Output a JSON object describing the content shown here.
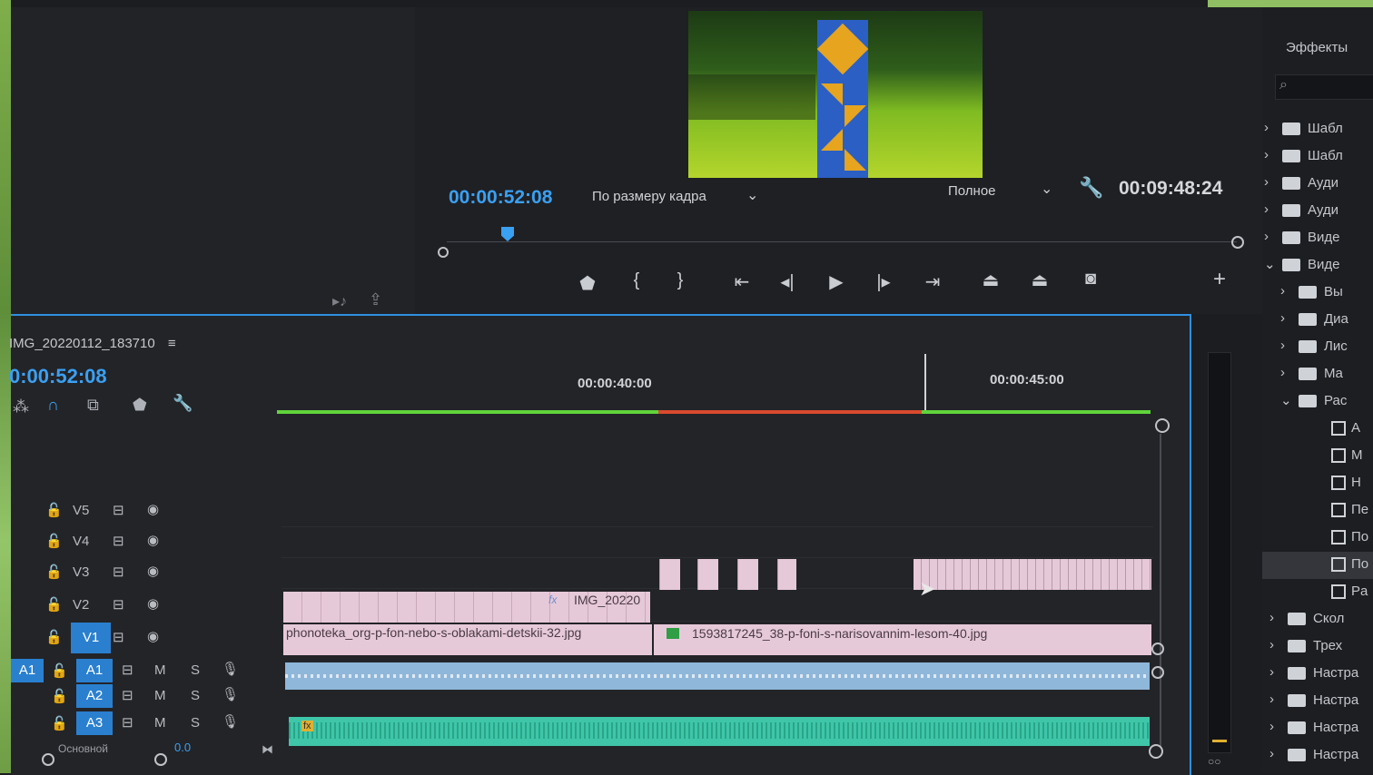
{
  "program": {
    "current_tc": "00:00:52:08",
    "fit": "По размеру кадра",
    "quality": "Полное",
    "duration_tc": "00:09:48:24"
  },
  "sequence": {
    "name": "IMG_20220112_183710",
    "current_tc": "0:00:52:08",
    "ruler_labels": [
      "00:00:40:00",
      "00:00:45:00"
    ]
  },
  "tracks": {
    "video": [
      {
        "name": "V5",
        "active": false
      },
      {
        "name": "V4",
        "active": false
      },
      {
        "name": "V3",
        "active": false
      },
      {
        "name": "V2",
        "active": false
      },
      {
        "name": "V1",
        "active": true
      }
    ],
    "audio": [
      {
        "src": "A1",
        "name": "A1",
        "m": "M",
        "s": "S"
      },
      {
        "src": "",
        "name": "A2",
        "m": "M",
        "s": "S"
      },
      {
        "src": "",
        "name": "A3",
        "m": "M",
        "s": "S"
      }
    ],
    "master_label": "Основной",
    "master_value": "0.0"
  },
  "clips": {
    "v2_clip": "IMG_20220",
    "v1_clip_a": "phonoteka_org-p-fon-nebo-s-oblakami-detskii-32.jpg",
    "v1_clip_b": "1593817245_38-p-foni-s-narisovannim-lesom-40.jpg",
    "fx_badge": "fx"
  },
  "effects": {
    "title": "Эффекты",
    "items": [
      {
        "kind": "bin",
        "arrow": "›",
        "label": "Шабл"
      },
      {
        "kind": "bin",
        "arrow": "›",
        "label": "Шабл"
      },
      {
        "kind": "folder",
        "arrow": "›",
        "label": "Ауди"
      },
      {
        "kind": "folder",
        "arrow": "›",
        "label": "Ауди"
      },
      {
        "kind": "folder",
        "arrow": "›",
        "label": "Виде"
      },
      {
        "kind": "folder",
        "arrow": "⌄",
        "label": "Виде"
      },
      {
        "kind": "folder",
        "arrow": "›",
        "label": "Вы"
      },
      {
        "kind": "folder",
        "arrow": "›",
        "label": "Диа"
      },
      {
        "kind": "folder",
        "arrow": "›",
        "label": "Лис"
      },
      {
        "kind": "folder",
        "arrow": "›",
        "label": "Ma"
      },
      {
        "kind": "folder",
        "arrow": "⌄",
        "label": "Рас"
      },
      {
        "kind": "preset",
        "arrow": "",
        "label": "A"
      },
      {
        "kind": "preset",
        "arrow": "",
        "label": "M"
      },
      {
        "kind": "preset",
        "arrow": "",
        "label": "H"
      },
      {
        "kind": "preset",
        "arrow": "",
        "label": "Пе"
      },
      {
        "kind": "preset",
        "arrow": "",
        "label": "По"
      },
      {
        "kind": "preset",
        "arrow": "",
        "label": "По"
      },
      {
        "kind": "preset",
        "arrow": "",
        "label": "Pa"
      },
      {
        "kind": "folder",
        "arrow": "›",
        "label": "Скол"
      },
      {
        "kind": "folder",
        "arrow": "›",
        "label": "Трех"
      },
      {
        "kind": "folder",
        "arrow": "›",
        "label": "Настра"
      },
      {
        "kind": "folder",
        "arrow": "›",
        "label": "Настра"
      },
      {
        "kind": "folder",
        "arrow": "›",
        "label": "Настра"
      },
      {
        "kind": "folder",
        "arrow": "›",
        "label": "Настра"
      }
    ]
  }
}
